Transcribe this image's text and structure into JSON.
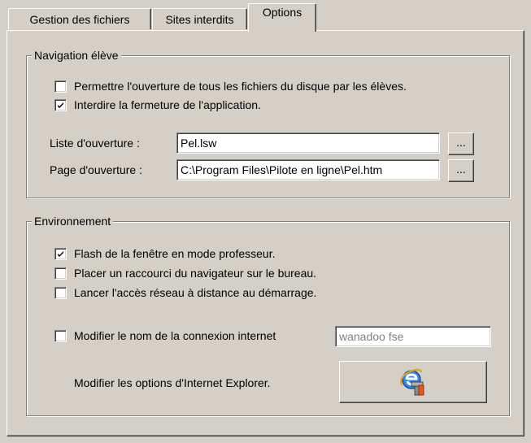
{
  "tabs": [
    {
      "label": "Gestion des fichiers"
    },
    {
      "label": "Sites interdits"
    },
    {
      "label": "Options"
    }
  ],
  "navigation": {
    "title": "Navigation élève",
    "checkbox_all_files": {
      "label": "Permettre l'ouverture de tous les fichiers du disque par les élèves.",
      "checked": false
    },
    "checkbox_no_close": {
      "label": "Interdire la fermeture de l'application.",
      "checked": true
    },
    "list_label": "Liste d'ouverture :",
    "list_value": "Pel.lsw",
    "page_label": "Page d'ouverture :",
    "page_value": "C:\\Program Files\\Pilote en ligne\\Pel.htm",
    "browse_label": "..."
  },
  "environment": {
    "title": "Environnement",
    "checkbox_flash": {
      "label": "Flash de la fenêtre en mode professeur.",
      "checked": true
    },
    "checkbox_shortcut": {
      "label": "Placer un raccourci du navigateur sur le bureau.",
      "checked": false
    },
    "checkbox_remote": {
      "label": "Lancer l'accès réseau à distance au démarrage.",
      "checked": false
    },
    "checkbox_connection": {
      "label": "Modifier le nom de la connexion internet",
      "checked": false
    },
    "connection_value": "wanadoo fse",
    "ie_options_label": "Modifier les options d'Internet Explorer.",
    "ie_icon": "internet-explorer-settings-icon"
  },
  "colors": {
    "face": "#d4d0c8",
    "shadow": "#808080",
    "highlight": "#ffffff",
    "ie_blue": "#1f6fd6",
    "ie_orange": "#e8a020"
  }
}
